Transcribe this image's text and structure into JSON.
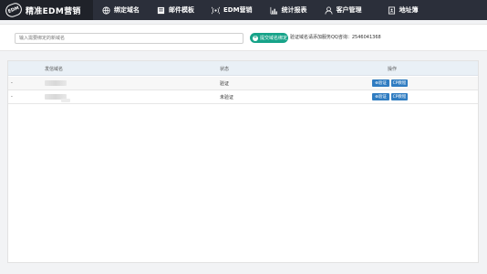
{
  "header": {
    "logo_badge": "EDM",
    "logo_text": "精准EDM营销",
    "nav": [
      {
        "label": "绑定域名",
        "icon": "globe-icon"
      },
      {
        "label": "邮件模板",
        "icon": "template-icon"
      },
      {
        "label": "EDM营销",
        "icon": "broadcast-icon"
      },
      {
        "label": "统计报表",
        "icon": "chart-icon"
      },
      {
        "label": "客户管理",
        "icon": "user-icon"
      },
      {
        "label": "地址簿",
        "icon": "address-book-icon"
      }
    ]
  },
  "search": {
    "placeholder": "输入需要绑定的新域名",
    "bind_button": "提交域名绑定",
    "bind_icon": "+",
    "hint": "验证域名请添加服务QQ咨询：2546041368"
  },
  "table": {
    "columns": {
      "domain": "发信域名",
      "status": "状态",
      "actions": "操作"
    },
    "rows": [
      {
        "marker": "-",
        "status": "验证",
        "verify": "⊕验证",
        "tutorial": "CP教程"
      },
      {
        "marker": "-",
        "status": "未验证",
        "verify": "⊕验证",
        "tutorial": "CP教程"
      }
    ]
  },
  "colors": {
    "topbar": "#2b2f3a",
    "accent_green": "#17a389",
    "button_blue": "#2f7cc1"
  }
}
